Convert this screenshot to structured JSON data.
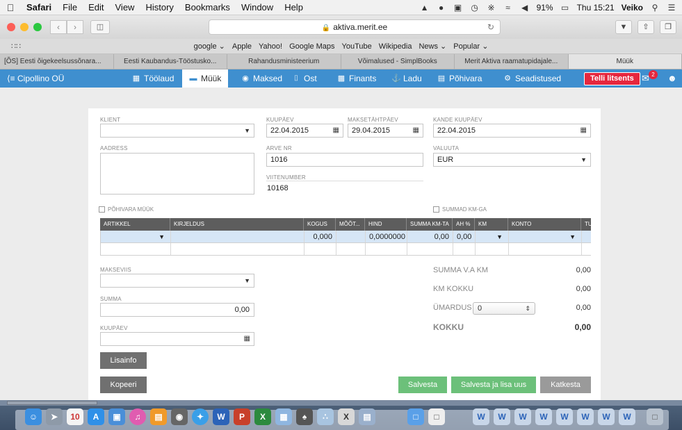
{
  "menubar": {
    "apple": "",
    "items": [
      "Safari",
      "File",
      "Edit",
      "View",
      "History",
      "Bookmarks",
      "Window",
      "Help"
    ],
    "battery": "91%",
    "clock": "Thu 15:21",
    "user": "Veiko"
  },
  "toolbar": {
    "url": "aktiva.merit.ee"
  },
  "favorites": [
    "google ⌄",
    "Apple",
    "Yahoo!",
    "Google Maps",
    "YouTube",
    "Wikipedia",
    "News ⌄",
    "Popular ⌄"
  ],
  "tabs": [
    "[ÕS] Eesti õigekeelsussõnara...",
    "Eesti Kaubandus-Tööstusko...",
    "Rahandusministeerium",
    "Võimalused - SimplBooks",
    "Merit Aktiva raamatupidajale...",
    "Müük"
  ],
  "appnav": {
    "company": "⟨≡ Cipollino OÜ",
    "items": {
      "toolaud": "Töölaud",
      "muuk": "Müük",
      "maksed": "Maksed",
      "ost": "Ost",
      "finants": "Finants",
      "ladu": "Ladu",
      "pohivara": "Põhivara",
      "seadistused": "Seadistused"
    },
    "license": "Telli litsents",
    "notifications": "2"
  },
  "form": {
    "klient_label": "KLIENT",
    "klient_value": "",
    "aadress_label": "AADRESS",
    "kuupaev_label": "KUUPÄEV",
    "kuupaev_value": "22.04.2015",
    "maksetahtaeg_label": "MAKSETÄHTPÄEV",
    "maksetahtaeg_value": "29.04.2015",
    "kande_label": "KANDE KUUPÄEV",
    "kande_value": "22.04.2015",
    "arvenr_label": "ARVE NR",
    "arvenr_value": "1016",
    "valuuta_label": "VALUUTA",
    "valuuta_value": "EUR",
    "viitenumber_label": "VIITENUMBER",
    "viitenumber_value": "10168",
    "pohivara_check": "PÕHIVARA MÜÜK",
    "summad_check": "SUMMAD KM-GA"
  },
  "table": {
    "headers": {
      "artikkel": "ARTIKKEL",
      "kirjeldus": "KIRJELDUS",
      "kogus": "KOGUS",
      "moot": "MÕÕT...",
      "hind": "HIND",
      "summa": "SUMMA KM-TA",
      "ah": "AH %",
      "km": "KM",
      "konto": "KONTO",
      "tu": "TU"
    },
    "row": {
      "kogus": "0,000",
      "hind": "0,0000000",
      "summa": "0,00",
      "ah": "0,00"
    }
  },
  "payment": {
    "makseviis_label": "MAKSEVIIS",
    "summa_label": "SUMMA",
    "summa_value": "0,00",
    "kuupaev_label": "KUUPÄEV"
  },
  "totals": {
    "summa_vakm_label": "SUMMA V.A KM",
    "summa_vakm_value": "0,00",
    "km_kokku_label": "KM KOKKU",
    "km_kokku_value": "0,00",
    "umardus_label": "ÜMARDUS",
    "umardus_select": "0",
    "umardus_value": "0,00",
    "kokku_label": "KOKKU",
    "kokku_value": "0,00"
  },
  "buttons": {
    "lisainfo": "Lisainfo",
    "kopeeri": "Kopeeri",
    "salvesta": "Salvesta",
    "salvesta_lisa": "Salvesta ja lisa uus",
    "katkesta": "Katkesta"
  },
  "dock": {
    "calendar_day": "10"
  },
  "colors": {
    "nav": "#3f8fcf",
    "license": "#e5273e",
    "save": "#6cc07a"
  }
}
